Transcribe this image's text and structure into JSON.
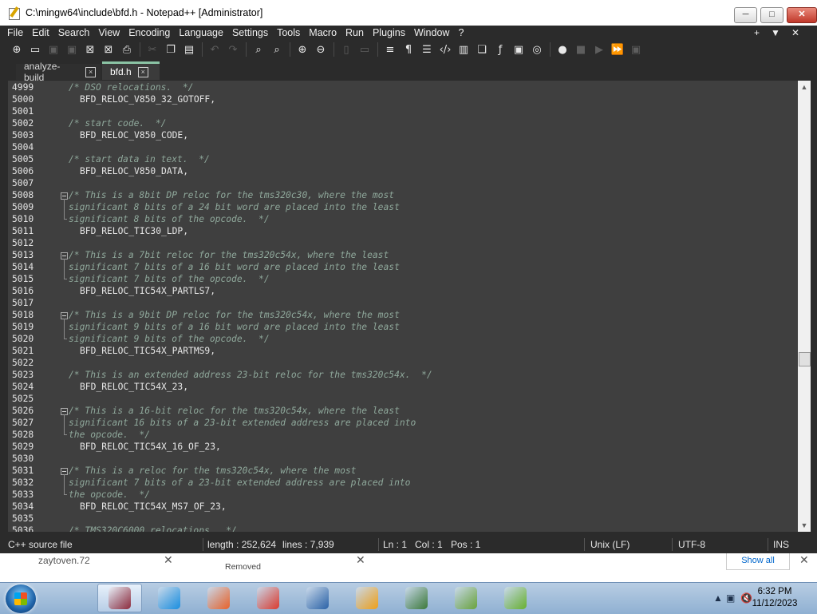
{
  "window": {
    "title": "C:\\mingw64\\include\\bfd.h - Notepad++ [Administrator]",
    "controls": {
      "minimize": "─",
      "maximize": "□",
      "close": "✕"
    }
  },
  "menu": {
    "items": [
      "File",
      "Edit",
      "Search",
      "View",
      "Encoding",
      "Language",
      "Settings",
      "Tools",
      "Macro",
      "Run",
      "Plugins",
      "Window",
      "?"
    ],
    "right": [
      "+",
      "▼",
      "✕"
    ]
  },
  "toolbar": {
    "icons": [
      {
        "name": "new-file-icon",
        "glyph": "⊕",
        "dim": false
      },
      {
        "name": "open-file-icon",
        "glyph": "▭",
        "dim": false
      },
      {
        "name": "save-icon",
        "glyph": "▣",
        "dim": true
      },
      {
        "name": "save-all-icon",
        "glyph": "▣",
        "dim": true
      },
      {
        "name": "close-icon",
        "glyph": "⊠",
        "dim": false
      },
      {
        "name": "close-all-icon",
        "glyph": "⊠",
        "dim": false
      },
      {
        "name": "print-icon",
        "glyph": "⎙",
        "dim": false
      },
      {
        "name": "sep"
      },
      {
        "name": "cut-icon",
        "glyph": "✂",
        "dim": true
      },
      {
        "name": "copy-icon",
        "glyph": "❐",
        "dim": false
      },
      {
        "name": "paste-icon",
        "glyph": "▤",
        "dim": false
      },
      {
        "name": "sep"
      },
      {
        "name": "undo-icon",
        "glyph": "↶",
        "dim": true
      },
      {
        "name": "redo-icon",
        "glyph": "↷",
        "dim": true
      },
      {
        "name": "sep"
      },
      {
        "name": "find-icon",
        "glyph": "⌕",
        "dim": false
      },
      {
        "name": "replace-icon",
        "glyph": "⌕",
        "dim": false
      },
      {
        "name": "sep"
      },
      {
        "name": "zoom-in-icon",
        "glyph": "⊕",
        "dim": false
      },
      {
        "name": "zoom-out-icon",
        "glyph": "⊖",
        "dim": false
      },
      {
        "name": "sep"
      },
      {
        "name": "sync-vertical-icon",
        "glyph": "▯",
        "dim": true
      },
      {
        "name": "sync-horizontal-icon",
        "glyph": "▭",
        "dim": true
      },
      {
        "name": "sep"
      },
      {
        "name": "word-wrap-icon",
        "glyph": "≡",
        "dim": false
      },
      {
        "name": "show-all-chars-icon",
        "glyph": "¶",
        "dim": false
      },
      {
        "name": "indent-guide-icon",
        "glyph": "☰",
        "dim": false
      },
      {
        "name": "xml-tag-icon",
        "glyph": "‹/›",
        "dim": false
      },
      {
        "name": "document-map-icon",
        "glyph": "▥",
        "dim": false
      },
      {
        "name": "document-list-icon",
        "glyph": "❏",
        "dim": false
      },
      {
        "name": "function-list-icon",
        "glyph": "ƒ",
        "dim": false
      },
      {
        "name": "folder-as-workspace-icon",
        "glyph": "▣",
        "dim": false
      },
      {
        "name": "monitoring-icon",
        "glyph": "◎",
        "dim": false
      },
      {
        "name": "sep"
      },
      {
        "name": "record-macro-icon",
        "glyph": "●",
        "dim": false
      },
      {
        "name": "stop-macro-icon",
        "glyph": "■",
        "dim": true
      },
      {
        "name": "play-macro-icon",
        "glyph": "▶",
        "dim": true
      },
      {
        "name": "run-macro-multiple-icon",
        "glyph": "⏩",
        "dim": false
      },
      {
        "name": "save-macro-icon",
        "glyph": "▣",
        "dim": true
      }
    ]
  },
  "tabs": [
    {
      "label": "analyze-build",
      "active": false
    },
    {
      "label": "bfd.h",
      "active": true
    }
  ],
  "editor": {
    "first_line": 4999,
    "lines": [
      {
        "n": "4999",
        "text": "/* DSO relocations.  */",
        "kind": "comment",
        "indent": 0
      },
      {
        "n": "5000",
        "text": "BFD_RELOC_V850_32_GOTOFF,",
        "kind": "text",
        "indent": 2
      },
      {
        "n": "5001",
        "text": "",
        "kind": "text",
        "indent": 0
      },
      {
        "n": "5002",
        "text": "/* start code.  */",
        "kind": "comment",
        "indent": 0
      },
      {
        "n": "5003",
        "text": "BFD_RELOC_V850_CODE,",
        "kind": "text",
        "indent": 2
      },
      {
        "n": "5004",
        "text": "",
        "kind": "text",
        "indent": 0
      },
      {
        "n": "5005",
        "text": "/* start data in text.  */",
        "kind": "comment",
        "indent": 0
      },
      {
        "n": "5006",
        "text": "BFD_RELOC_V850_DATA,",
        "kind": "text",
        "indent": 2
      },
      {
        "n": "5007",
        "text": "",
        "kind": "text",
        "indent": 0
      },
      {
        "n": "5008",
        "text": "/* This is a 8bit DP reloc for the tms320c30, where the most",
        "kind": "comment",
        "indent": 0,
        "fold": "start"
      },
      {
        "n": "5009",
        "text": "significant 8 bits of a 24 bit word are placed into the least",
        "kind": "comment",
        "indent": 0,
        "fold": "mid"
      },
      {
        "n": "5010",
        "text": "significant 8 bits of the opcode.  */",
        "kind": "comment",
        "indent": 0,
        "fold": "end"
      },
      {
        "n": "5011",
        "text": "BFD_RELOC_TIC30_LDP,",
        "kind": "text",
        "indent": 2
      },
      {
        "n": "5012",
        "text": "",
        "kind": "text",
        "indent": 0
      },
      {
        "n": "5013",
        "text": "/* This is a 7bit reloc for the tms320c54x, where the least",
        "kind": "comment",
        "indent": 0,
        "fold": "start"
      },
      {
        "n": "5014",
        "text": "significant 7 bits of a 16 bit word are placed into the least",
        "kind": "comment",
        "indent": 0,
        "fold": "mid"
      },
      {
        "n": "5015",
        "text": "significant 7 bits of the opcode.  */",
        "kind": "comment",
        "indent": 0,
        "fold": "end"
      },
      {
        "n": "5016",
        "text": "BFD_RELOC_TIC54X_PARTLS7,",
        "kind": "text",
        "indent": 2
      },
      {
        "n": "5017",
        "text": "",
        "kind": "text",
        "indent": 0
      },
      {
        "n": "5018",
        "text": "/* This is a 9bit DP reloc for the tms320c54x, where the most",
        "kind": "comment",
        "indent": 0,
        "fold": "start"
      },
      {
        "n": "5019",
        "text": "significant 9 bits of a 16 bit word are placed into the least",
        "kind": "comment",
        "indent": 0,
        "fold": "mid"
      },
      {
        "n": "5020",
        "text": "significant 9 bits of the opcode.  */",
        "kind": "comment",
        "indent": 0,
        "fold": "end"
      },
      {
        "n": "5021",
        "text": "BFD_RELOC_TIC54X_PARTMS9,",
        "kind": "text",
        "indent": 2
      },
      {
        "n": "5022",
        "text": "",
        "kind": "text",
        "indent": 0
      },
      {
        "n": "5023",
        "text": "/* This is an extended address 23-bit reloc for the tms320c54x.  */",
        "kind": "comment",
        "indent": 0
      },
      {
        "n": "5024",
        "text": "BFD_RELOC_TIC54X_23,",
        "kind": "text",
        "indent": 2
      },
      {
        "n": "5025",
        "text": "",
        "kind": "text",
        "indent": 0
      },
      {
        "n": "5026",
        "text": "/* This is a 16-bit reloc for the tms320c54x, where the least",
        "kind": "comment",
        "indent": 0,
        "fold": "start"
      },
      {
        "n": "5027",
        "text": "significant 16 bits of a 23-bit extended address are placed into",
        "kind": "comment",
        "indent": 0,
        "fold": "mid"
      },
      {
        "n": "5028",
        "text": "the opcode.  */",
        "kind": "comment",
        "indent": 0,
        "fold": "end"
      },
      {
        "n": "5029",
        "text": "BFD_RELOC_TIC54X_16_OF_23,",
        "kind": "text",
        "indent": 2
      },
      {
        "n": "5030",
        "text": "",
        "kind": "text",
        "indent": 0
      },
      {
        "n": "5031",
        "text": "/* This is a reloc for the tms320c54x, where the most",
        "kind": "comment",
        "indent": 0,
        "fold": "start"
      },
      {
        "n": "5032",
        "text": "significant 7 bits of a 23-bit extended address are placed into",
        "kind": "comment",
        "indent": 0,
        "fold": "mid"
      },
      {
        "n": "5033",
        "text": "the opcode.  */",
        "kind": "comment",
        "indent": 0,
        "fold": "end"
      },
      {
        "n": "5034",
        "text": "BFD_RELOC_TIC54X_MS7_OF_23,",
        "kind": "text",
        "indent": 2
      },
      {
        "n": "5035",
        "text": "",
        "kind": "text",
        "indent": 0
      },
      {
        "n": "5036",
        "text": "/* TMS320C6000 relocations.  */",
        "kind": "comment",
        "indent": 0
      }
    ]
  },
  "statusbar": {
    "language": "C++ source file",
    "length": "length : 252,624",
    "lines": "lines : 7,939",
    "ln": "Ln : 1",
    "col": "Col : 1",
    "pos": "Pos : 1",
    "eol": "Unix (LF)",
    "encoding": "UTF-8",
    "mode": "INS"
  },
  "background_window": {
    "text1": "zaytoven.72",
    "text2": "Removed",
    "show_all": "Show all"
  },
  "taskbar": {
    "apps": [
      {
        "name": "winrar-app-icon",
        "color": "#8e2b3c",
        "active": true
      },
      {
        "name": "itunes-app-icon",
        "color": "#1b8fe0",
        "active": false
      },
      {
        "name": "firefox-app-icon",
        "color": "#e9632a",
        "active": false
      },
      {
        "name": "chrome-app-icon",
        "color": "#dc3c2f",
        "active": false
      },
      {
        "name": "virtualbox-app-icon",
        "color": "#2c63a7",
        "active": false
      },
      {
        "name": "search-app-icon",
        "color": "#f0a018",
        "active": false
      },
      {
        "name": "terminal-app-icon",
        "color": "#3e7a3a",
        "active": false
      },
      {
        "name": "notepadpp-app-icon",
        "color": "#6aa33c",
        "active": false
      },
      {
        "name": "chart-app-icon",
        "color": "#69b130",
        "active": false
      }
    ],
    "clock": {
      "time": "6:32 PM",
      "date": "11/12/2023"
    },
    "tray": {
      "arrow": "▲",
      "network": "▣",
      "volume": "🔇"
    }
  }
}
